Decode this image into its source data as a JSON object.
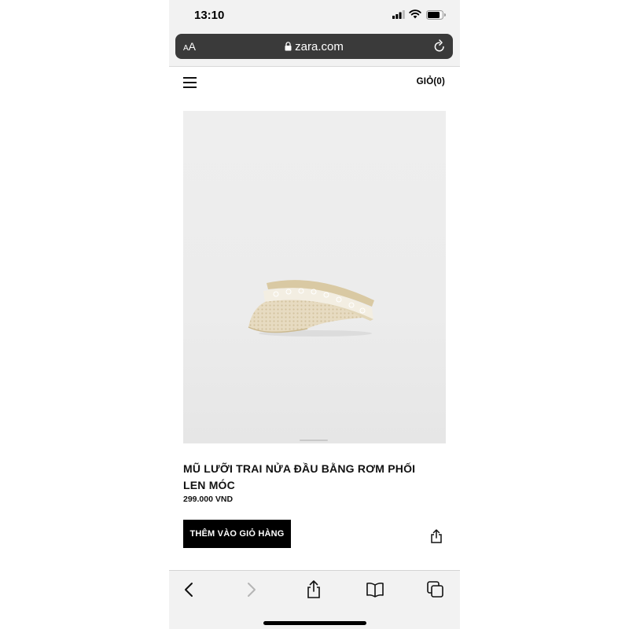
{
  "status_bar": {
    "time": "13:10"
  },
  "browser": {
    "text_size_small": "A",
    "text_size_large": "A",
    "url": "zara.com"
  },
  "header": {
    "cart_label": "GIỎ(0)"
  },
  "product": {
    "title": "MŨ LƯỠI TRAI NỬA ĐẦU BẰNG RƠM PHỐI LEN MÓC",
    "price": "299.000 VND",
    "add_to_cart_label": "THÊM VÀO GIỎ HÀNG"
  },
  "icons": {
    "status": [
      "signal-icon",
      "wifi-icon",
      "battery-icon"
    ],
    "browser_top": [
      "text-size-icon",
      "lock-icon",
      "reload-icon"
    ],
    "page": [
      "menu-icon",
      "share-icon"
    ],
    "toolbar": [
      "back-icon",
      "forward-icon",
      "share-icon",
      "bookmarks-icon",
      "tabs-icon"
    ]
  },
  "colors": {
    "button_bg": "#000000",
    "button_text": "#ffffff",
    "url_bar_bg": "#3a3a3a",
    "image_bg": "#ececec"
  }
}
